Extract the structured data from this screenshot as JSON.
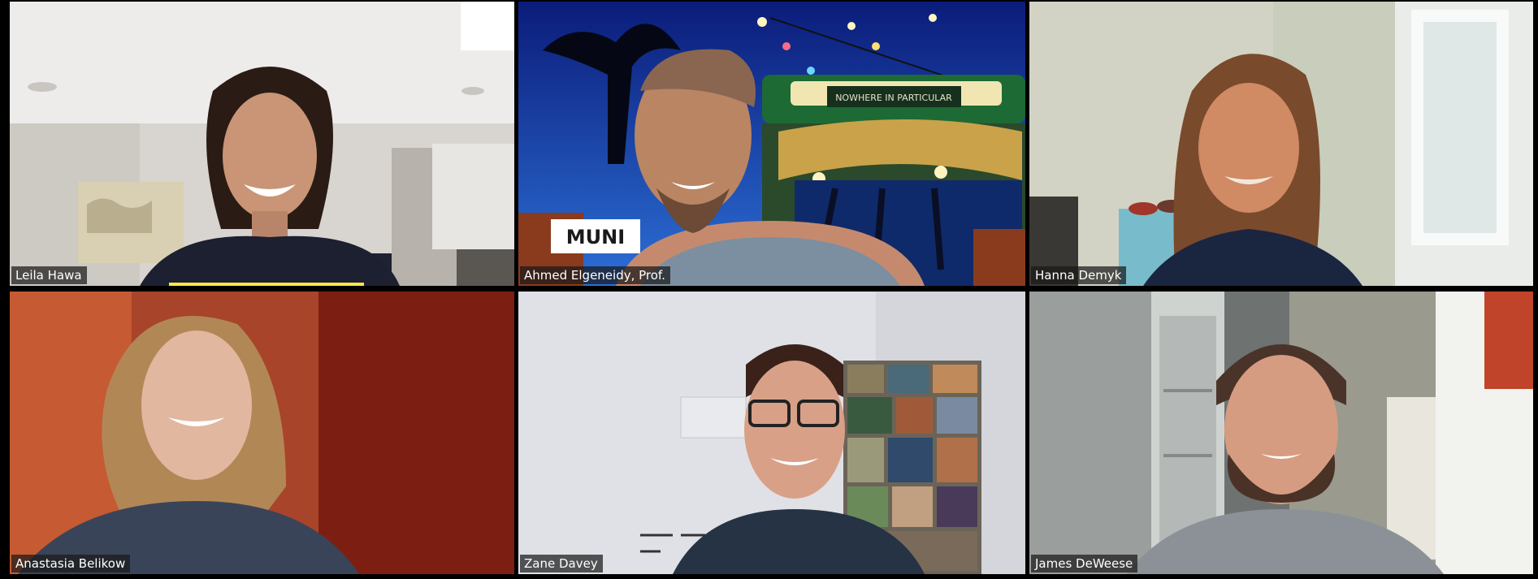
{
  "meeting": {
    "active_speaker_color": "#a6d64a",
    "audio_indicator_color": "#f7e64a",
    "participants": [
      {
        "name": "Leila Hawa"
      },
      {
        "name": "Ahmed Elgeneidy, Prof."
      },
      {
        "name": "Hanna Demyk"
      },
      {
        "name": "Anastasia Belikow"
      },
      {
        "name": "Zane Davey"
      },
      {
        "name": "James DeWeese"
      }
    ]
  },
  "background_sign": {
    "trolley_text": "NOWHERE IN PARTICULAR",
    "logo_text": "MUNI"
  }
}
